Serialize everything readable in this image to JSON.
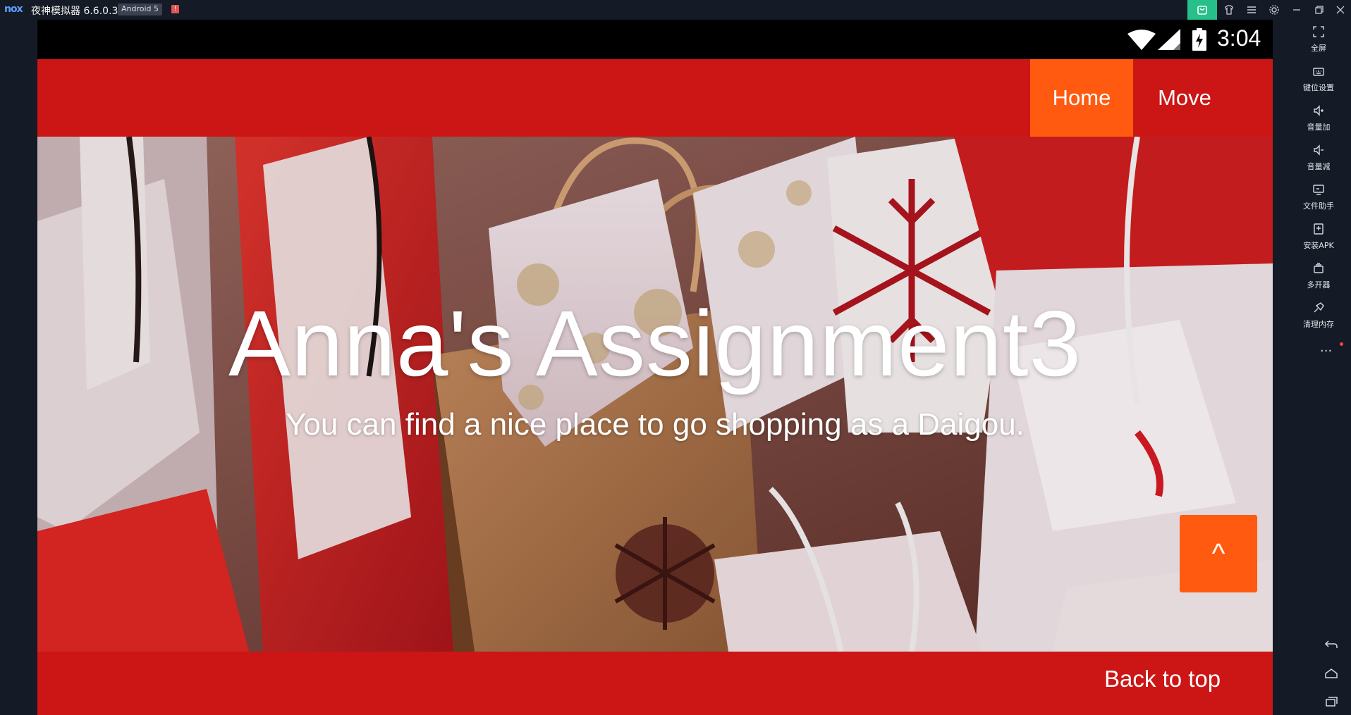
{
  "emulator": {
    "logo": "nox",
    "title": "夜神模拟器 6.6.0.3",
    "android_badge": "Android 5",
    "alert_glyph": "!",
    "window_buttons": [
      "store-icon",
      "skin-icon",
      "menu-icon",
      "settings-icon",
      "minimize-icon",
      "restore-icon",
      "close-icon"
    ]
  },
  "toolbar": {
    "items": [
      {
        "icon": "fullscreen-icon",
        "label": "全屏"
      },
      {
        "icon": "keymap-icon",
        "label": "键位设置"
      },
      {
        "icon": "volume-up-icon",
        "label": "音量加"
      },
      {
        "icon": "volume-down-icon",
        "label": "音量减"
      },
      {
        "icon": "file-assistant-icon",
        "label": "文件助手"
      },
      {
        "icon": "install-apk-icon",
        "label": "安装APK"
      },
      {
        "icon": "multi-instance-icon",
        "label": "多开器"
      },
      {
        "icon": "clean-memory-icon",
        "label": "清理内存"
      }
    ],
    "more": "...",
    "nav": [
      "back-icon",
      "home-icon",
      "recents-icon"
    ]
  },
  "statusbar": {
    "time": "3:04"
  },
  "app": {
    "nav": [
      {
        "label": "Home",
        "active": true
      },
      {
        "label": "Move",
        "active": false
      }
    ],
    "hero_title": "Anna's Assignment3",
    "hero_subtitle": "You can find a nice place to go shopping as a Daigou.",
    "scroll_top": "^",
    "footer_link": "Back to top"
  },
  "colors": {
    "primary_red": "#cc1515",
    "accent_orange": "#ff5a10",
    "emulator_bg": "#141a26"
  }
}
